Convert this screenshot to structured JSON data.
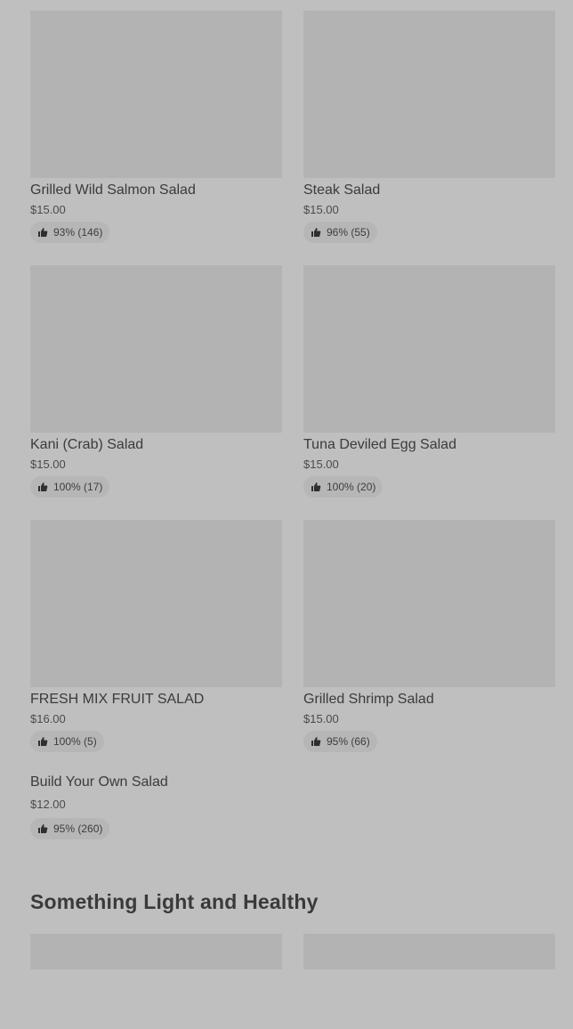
{
  "items": [
    {
      "name": "Grilled Wild Salmon Salad",
      "price": "$15.00",
      "rating": "93% (146)"
    },
    {
      "name": "Steak Salad",
      "price": "$15.00",
      "rating": "96% (55)"
    },
    {
      "name": "Kani (Crab) Salad",
      "price": "$15.00",
      "rating": "100% (17)"
    },
    {
      "name": "Tuna Deviled Egg Salad",
      "price": "$15.00",
      "rating": "100% (20)"
    },
    {
      "name": "FRESH MIX FRUIT SALAD",
      "price": "$16.00",
      "rating": "100% (5)"
    },
    {
      "name": "Grilled Shrimp Salad",
      "price": "$15.00",
      "rating": "95% (66)"
    },
    {
      "name": "Build Your Own Salad",
      "price": "$12.00",
      "rating": "95% (260)"
    }
  ],
  "section": {
    "title": "Something Light and Healthy"
  },
  "icons": {
    "rating": "thumbs-up-icon"
  }
}
